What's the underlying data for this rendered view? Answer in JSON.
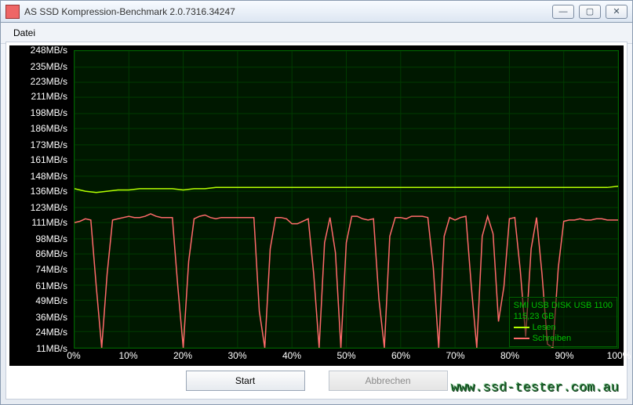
{
  "window": {
    "title": "AS SSD Kompression-Benchmark 2.0.7316.34247"
  },
  "menu": {
    "file": "Datei"
  },
  "buttons": {
    "start": "Start",
    "cancel": "Abbrechen"
  },
  "watermark": "www.ssd-tester.com.au",
  "legend": {
    "device": "SMI USB DISK USB 1100",
    "capacity": "115,23 GB",
    "read": "Lesen",
    "write": "Schreiben"
  },
  "colors": {
    "read": "#b4ff00",
    "write": "#ff6a6a",
    "grid": "#004400"
  },
  "chart_data": {
    "type": "line",
    "title": "",
    "xlabel": "",
    "ylabel": "",
    "xunit": "%",
    "yunit": "MB/s",
    "ylim": [
      11,
      248
    ],
    "xlim": [
      0,
      100
    ],
    "y_ticks": [
      11,
      24,
      36,
      49,
      61,
      74,
      86,
      98,
      111,
      123,
      136,
      148,
      161,
      173,
      186,
      198,
      211,
      223,
      235,
      248
    ],
    "x_ticks": [
      0,
      10,
      20,
      30,
      40,
      50,
      60,
      70,
      80,
      90,
      100
    ],
    "series": [
      {
        "name": "Lesen",
        "color": "#b4ff00",
        "x": [
          0,
          2,
          4,
          6,
          8,
          10,
          12,
          14,
          16,
          18,
          20,
          22,
          24,
          26,
          28,
          30,
          32,
          34,
          36,
          38,
          40,
          42,
          44,
          46,
          48,
          50,
          52,
          54,
          56,
          58,
          60,
          62,
          64,
          66,
          68,
          70,
          72,
          74,
          76,
          78,
          80,
          82,
          84,
          86,
          88,
          90,
          92,
          94,
          96,
          98,
          100
        ],
        "y": [
          138,
          136,
          135,
          136,
          137,
          137,
          138,
          138,
          138,
          138,
          137,
          138,
          138,
          139,
          139,
          139,
          139,
          139,
          139,
          139,
          139,
          139,
          139,
          139,
          139,
          139,
          139,
          139,
          139,
          139,
          139,
          139,
          139,
          139,
          139,
          139,
          139,
          139,
          139,
          139,
          139,
          139,
          139,
          139,
          139,
          139,
          139,
          139,
          139,
          139,
          140
        ]
      },
      {
        "name": "Schreiben",
        "color": "#ff6a6a",
        "x": [
          0,
          1,
          2,
          3,
          4,
          5,
          6,
          7,
          8,
          9,
          10,
          11,
          12,
          13,
          14,
          15,
          16,
          17,
          18,
          19,
          20,
          21,
          22,
          23,
          24,
          25,
          26,
          27,
          28,
          29,
          30,
          31,
          32,
          33,
          34,
          35,
          36,
          37,
          38,
          39,
          40,
          41,
          42,
          43,
          44,
          45,
          46,
          47,
          48,
          49,
          50,
          51,
          52,
          53,
          54,
          55,
          56,
          57,
          58,
          59,
          60,
          61,
          62,
          63,
          64,
          65,
          66,
          67,
          68,
          69,
          70,
          71,
          72,
          73,
          74,
          75,
          76,
          77,
          78,
          79,
          80,
          81,
          82,
          83,
          84,
          85,
          86,
          87,
          88,
          89,
          90,
          91,
          92,
          93,
          94,
          95,
          96,
          97,
          98,
          99,
          100
        ],
        "y": [
          111,
          112,
          114,
          113,
          60,
          11,
          70,
          113,
          114,
          115,
          116,
          115,
          115,
          116,
          118,
          116,
          115,
          115,
          115,
          60,
          11,
          80,
          114,
          116,
          117,
          115,
          114,
          115,
          115,
          115,
          115,
          115,
          115,
          115,
          40,
          11,
          90,
          115,
          115,
          114,
          110,
          110,
          112,
          114,
          70,
          11,
          95,
          115,
          87,
          11,
          95,
          116,
          116,
          114,
          113,
          114,
          50,
          11,
          100,
          115,
          115,
          114,
          116,
          116,
          116,
          115,
          75,
          11,
          100,
          115,
          113,
          115,
          116,
          60,
          11,
          100,
          116,
          102,
          32,
          60,
          114,
          115,
          73,
          20,
          90,
          115,
          70,
          14,
          11,
          75,
          112,
          113,
          113,
          114,
          113,
          113,
          114,
          114,
          113,
          113,
          113
        ]
      }
    ]
  }
}
